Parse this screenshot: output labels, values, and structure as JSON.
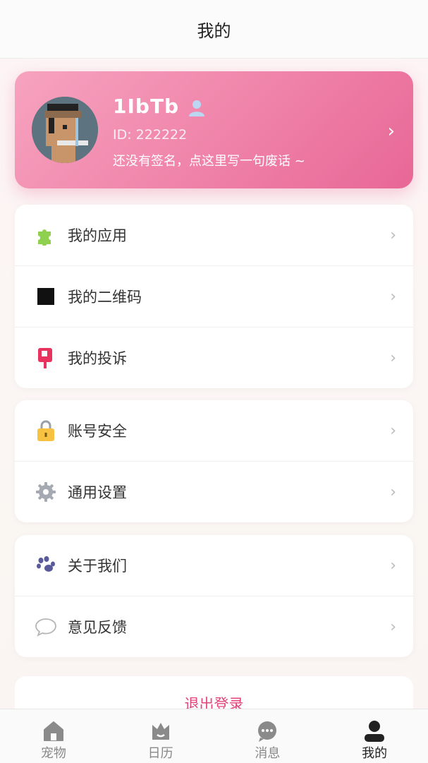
{
  "header": {
    "title": "我的"
  },
  "profile": {
    "name": "1IbTb",
    "id_text": "ID: 222222",
    "signature": "还没有签名，点这里写一句废话 ~",
    "chevron": "›"
  },
  "groups": [
    {
      "items": [
        {
          "icon": "puzzle-icon",
          "label": "我的应用"
        },
        {
          "icon": "qr-code-icon",
          "label": "我的二维码"
        },
        {
          "icon": "complaint-icon",
          "label": "我的投诉"
        }
      ]
    },
    {
      "items": [
        {
          "icon": "lock-icon",
          "label": "账号安全"
        },
        {
          "icon": "gear-icon",
          "label": "通用设置"
        }
      ]
    },
    {
      "items": [
        {
          "icon": "paw-icon",
          "label": "关于我们"
        },
        {
          "icon": "chat-bubble-icon",
          "label": "意见反馈"
        }
      ]
    }
  ],
  "row_chevron": "›",
  "logout_label": "退出登录",
  "tabbar": {
    "tabs": [
      {
        "icon": "house-icon",
        "label": "宠物",
        "active": false
      },
      {
        "icon": "calendar-icon",
        "label": "日历",
        "active": false
      },
      {
        "icon": "message-icon",
        "label": "消息",
        "active": false
      },
      {
        "icon": "person-icon",
        "label": "我的",
        "active": true
      }
    ]
  },
  "colors": {
    "accent": "#e0457b",
    "card_start": "#f7a3c0",
    "card_end": "#e86796"
  }
}
